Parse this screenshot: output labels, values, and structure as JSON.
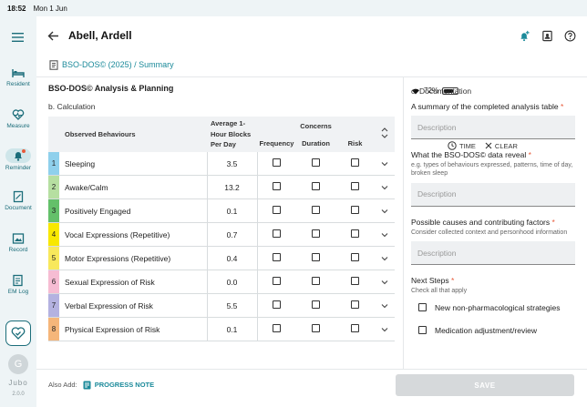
{
  "status_bar": {
    "time": "18:52",
    "date": "Mon 1 Jun",
    "battery": "72%",
    "battery_level": 0.72
  },
  "sidebar": {
    "items": [
      {
        "label": "Resident",
        "icon": "bed-icon"
      },
      {
        "label": "Measure",
        "icon": "heart-pulse-icon"
      },
      {
        "label": "Reminder",
        "icon": "bell-icon"
      },
      {
        "label": "Document",
        "icon": "document-icon"
      },
      {
        "label": "Record",
        "icon": "image-icon"
      },
      {
        "label": "EM Log",
        "icon": "log-icon"
      }
    ],
    "avatar_initial": "G",
    "logo": "Jubo",
    "version": "2.0.0"
  },
  "header": {
    "title": "Abell, Ardell"
  },
  "subheader": {
    "crumb": "BSO-DOS© (2025) / Summary",
    "time_label": "TIME",
    "clear_label": "CLEAR"
  },
  "analysis": {
    "heading": "BSO-DOS© Analysis & Planning",
    "section_b": "b. Calculation",
    "table": {
      "col_behaviours": "Observed Behaviours",
      "col_avg": "Average 1-Hour Blocks Per Day",
      "col_concerns": "Concerns",
      "col_frequency": "Frequency",
      "col_duration": "Duration",
      "col_risk": "Risk",
      "rows": [
        {
          "num": "1",
          "name": "Sleeping",
          "avg": "3.5",
          "color": "#8fd0ec"
        },
        {
          "num": "2",
          "name": "Awake/Calm",
          "avg": "13.2",
          "color": "#b6dfa1"
        },
        {
          "num": "3",
          "name": "Positively Engaged",
          "avg": "0.1",
          "color": "#64c06a"
        },
        {
          "num": "4",
          "name": "Vocal Expressions (Repetitive)",
          "avg": "0.7",
          "color": "#f8e800"
        },
        {
          "num": "5",
          "name": "Motor Expressions (Repetitive)",
          "avg": "0.4",
          "color": "#f8e85c"
        },
        {
          "num": "6",
          "name": "Sexual Expression of Risk",
          "avg": "0.0",
          "color": "#f6bcd3"
        },
        {
          "num": "7",
          "name": "Verbal Expression of Risk",
          "avg": "5.5",
          "color": "#b4b2e0"
        },
        {
          "num": "8",
          "name": "Physical Expression of Risk",
          "avg": "0.1",
          "color": "#f5b67a"
        }
      ]
    }
  },
  "documentation": {
    "section_c": "c. Documentation",
    "q1": "A summary of the completed analysis table",
    "q1_placeholder": "Description",
    "q2": "What the BSO-DOS© data reveal",
    "q2_hint": "e.g. types of behaviours expressed, patterns, time of day, broken sleep",
    "q2_placeholder": "Description",
    "q3": "Possible causes and contributing factors",
    "q3_hint": "Consider collected context and personhood information",
    "q3_placeholder": "Description",
    "q4": "Next Steps",
    "q4_hint": "Check all that apply",
    "steps": [
      "New non-pharmacological strategies",
      "Medication adjustment/review"
    ],
    "required_mark": "*"
  },
  "bottom": {
    "also_add": "Also Add:",
    "progress_note": "PROGRESS NOTE",
    "save": "SAVE"
  },
  "colors": {
    "accent": "#1b8a9a",
    "required": "#e85a3a"
  }
}
